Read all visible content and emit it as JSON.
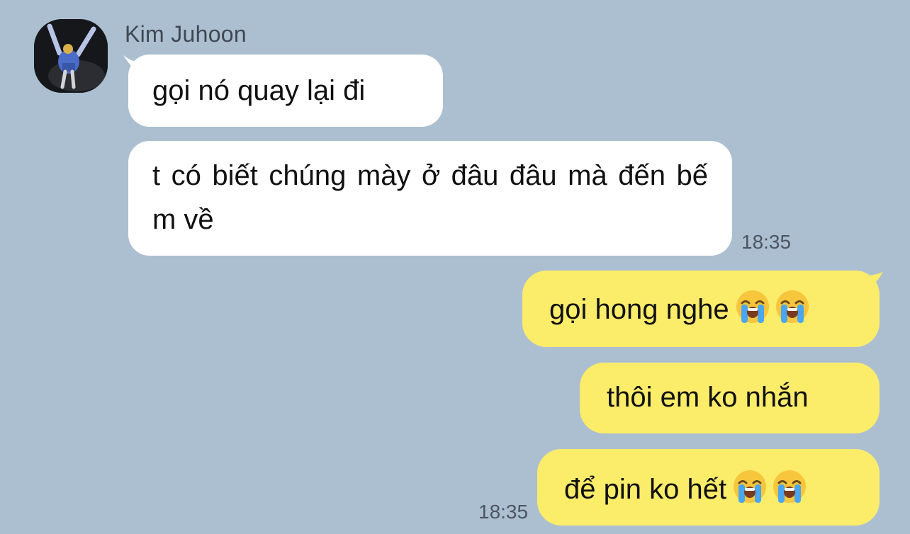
{
  "contact": {
    "name": "Kim Juhoon"
  },
  "messages": [
    {
      "direction": "incoming",
      "text": "gọi nó quay lại đi"
    },
    {
      "direction": "incoming",
      "text": "t có biết chúng mày ở đâu đâu mà đến bế m về"
    },
    {
      "direction": "outgoing",
      "text": "gọi hong nghe",
      "emojis": [
        "loudly-crying-face-icon",
        "loudly-crying-face-icon"
      ]
    },
    {
      "direction": "outgoing",
      "text": "thôi em ko nhắn"
    },
    {
      "direction": "outgoing",
      "text": "để pin ko hết",
      "emojis": [
        "loudly-crying-face-icon",
        "loudly-crying-face-icon"
      ]
    }
  ],
  "timestamps": {
    "incoming_group": "18:35",
    "outgoing_group": "18:35"
  },
  "colors": {
    "background": "#acbfd1",
    "incoming_bubble": "#ffffff",
    "outgoing_bubble": "#fbec6a",
    "timestamp": "#4c5560"
  }
}
